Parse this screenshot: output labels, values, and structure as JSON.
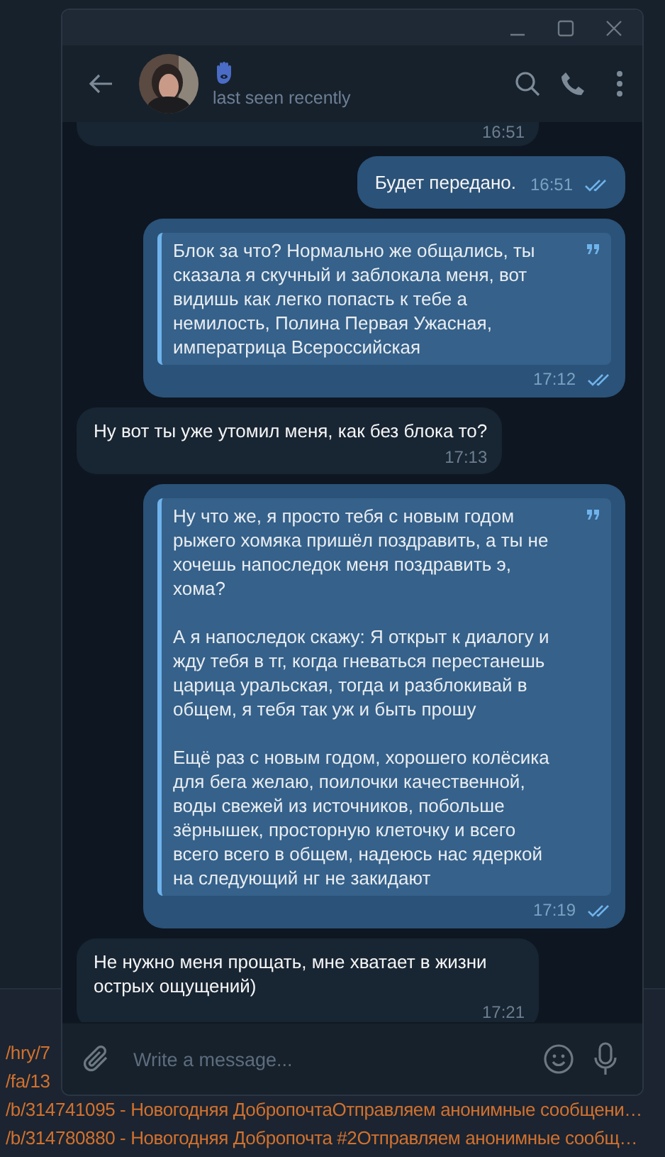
{
  "window": {
    "contact": {
      "status": "last seen recently"
    }
  },
  "messages": [
    {
      "kind": "fragment",
      "outgoing": false,
      "time": "16:51"
    },
    {
      "kind": "text",
      "outgoing": true,
      "paragraphs": [
        "Будет передано."
      ],
      "time": "16:51",
      "read": true
    },
    {
      "kind": "quote",
      "outgoing": true,
      "paragraphs": [
        "Блок за что? Нормально же общались, ты сказала я скучный и заблокала меня, вот видишь как легко попасть к тебе а немилость, Полина Первая Ужасная, императрица Всероссийская"
      ],
      "time": "17:12",
      "read": true
    },
    {
      "kind": "text",
      "outgoing": false,
      "paragraphs": [
        "Ну вот ты уже утомил меня, как без блока то?"
      ],
      "time": "17:13"
    },
    {
      "kind": "quote",
      "outgoing": true,
      "paragraphs": [
        "Ну что же, я просто тебя с новым годом рыжего хомяка пришёл поздравить, а ты не хочешь напоследок меня поздравить э, хома?",
        "А я напоследок скажу: Я открыт к диалогу и жду тебя в тг, когда гневаться перестанешь царица уральская, тогда и разблокивай в общем, я тебя так уж и быть прошу",
        "Ещё раз с новым годом, хорошего колёсика для бега желаю, поилочки качественной, воды свежей из источников, побольше зёрнышек, просторную клеточку и всего всего всего в общем, надеюсь нас ядеркой на следующий нг не закидают"
      ],
      "time": "17:19",
      "read": true
    },
    {
      "kind": "text",
      "outgoing": false,
      "paragraphs": [
        "Не нужно меня прощать, мне хватает в жизни острых ощущений)"
      ],
      "time": "17:21"
    }
  ],
  "composer": {
    "placeholder": "Write a message..."
  },
  "background_links": [
    "/hry/7",
    "/fa/13",
    "/b/314741095 - Новогодняя ДобропочтаОтправляем анонимные сообщени…",
    "/b/314780880 - Новогодняя Добропочта #2Отправляем анонимные сообщ…"
  ]
}
